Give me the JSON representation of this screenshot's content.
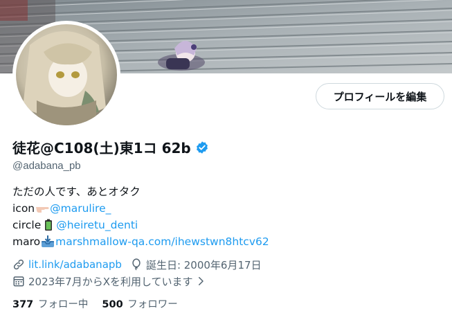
{
  "profile": {
    "display_name": "徒花@C108(土)東1コ 62b",
    "handle": "@adabana_pb",
    "edit_button_label": "プロフィールを編集",
    "bio": {
      "line1": "ただの人です、あとオタク",
      "line2_prefix": "icon",
      "line2_link": "@marulire_",
      "line3_prefix": "circle",
      "line3_link": "@heiretu_denti",
      "line4_prefix": "maro",
      "line4_link": "marshmallow-qa.com/ihewstwn8htcv62"
    },
    "website": "lit.link/adabanapb",
    "birthday": "誕生日: 2000年6月17日",
    "joined": "2023年7月からXを利用しています",
    "following_count": "377",
    "following_label": "フォロー中",
    "followers_count": "500",
    "followers_label": "フォロワー"
  },
  "colors": {
    "accent": "#1d9bf0",
    "secondary_text": "#536471",
    "primary_text": "#0f1419"
  },
  "icons": [
    "verified-badge-icon",
    "link-icon",
    "balloon-icon",
    "calendar-icon",
    "chevron-right-icon",
    "pointing-hand-emoji",
    "battery-emoji",
    "inbox-tray-emoji"
  ]
}
